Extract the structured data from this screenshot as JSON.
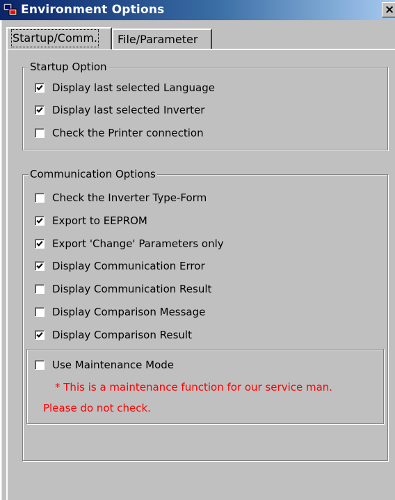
{
  "window": {
    "title": "Environment Options",
    "close_glyph": "×",
    "icon": "app-icon"
  },
  "tabs": [
    {
      "label": "Startup/Comm.",
      "active": true
    },
    {
      "label": "File/Parameter",
      "active": false
    }
  ],
  "startup": {
    "legend": "Startup Option",
    "options": [
      {
        "label": "Display last selected Language",
        "checked": true
      },
      {
        "label": "Display last selected Inverter",
        "checked": true
      },
      {
        "label": "Check the Printer connection",
        "checked": false
      }
    ]
  },
  "communication": {
    "legend": "Communication Options",
    "options": [
      {
        "label": "Check the Inverter Type-Form",
        "checked": false
      },
      {
        "label": "Export to EEPROM",
        "checked": true
      },
      {
        "label": "Export 'Change' Parameters only",
        "checked": true
      },
      {
        "label": "Display Communication Error",
        "checked": true
      },
      {
        "label": "Display Communication Result",
        "checked": false
      },
      {
        "label": "Display Comparison Message",
        "checked": false
      },
      {
        "label": "Display Comparison Result",
        "checked": true
      }
    ]
  },
  "maintenance": {
    "label": "Use Maintenance Mode",
    "checked": false,
    "note_line1": "* This is a maintenance function for our service man.",
    "note_line2": "Please do not check.",
    "note_color": "#ff0000"
  }
}
